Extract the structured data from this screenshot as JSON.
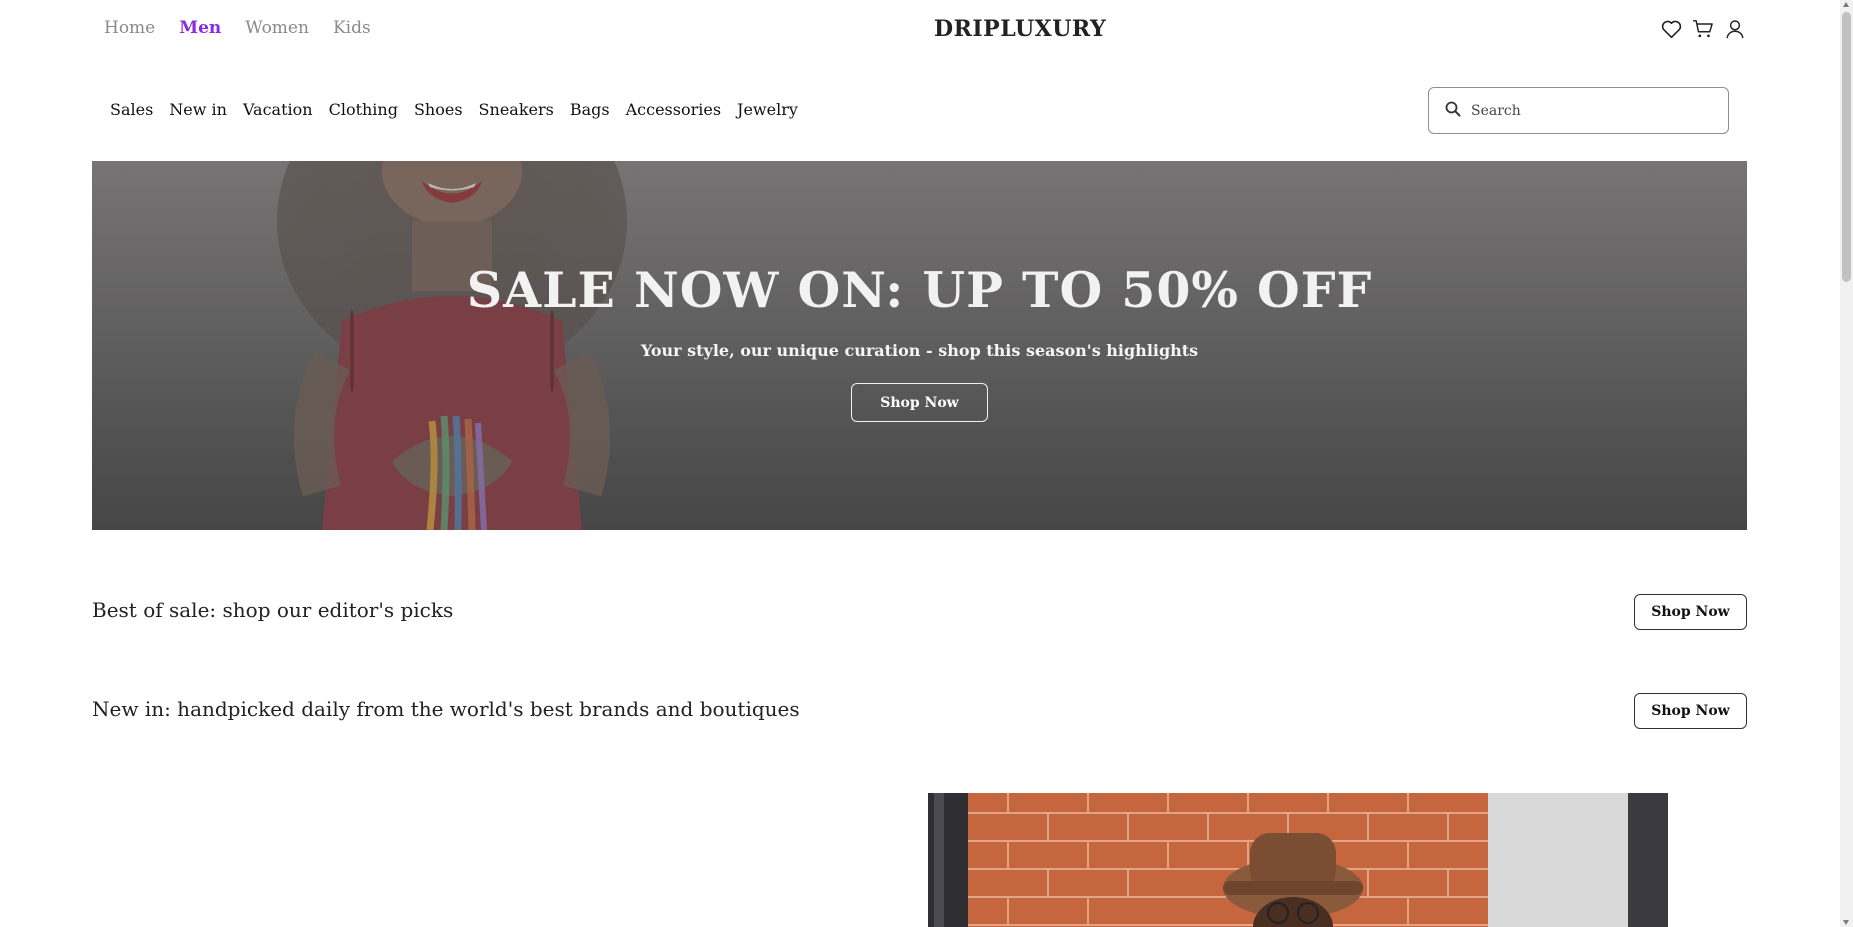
{
  "gender_nav": {
    "items": [
      {
        "label": "Home",
        "active": false
      },
      {
        "label": "Men",
        "active": true
      },
      {
        "label": "Women",
        "active": false
      },
      {
        "label": "Kids",
        "active": false
      }
    ]
  },
  "brand": {
    "name": "DRIPLUXURY"
  },
  "top_icons": [
    "heart-icon",
    "cart-icon",
    "user-icon"
  ],
  "category_nav": {
    "items": [
      "Sales",
      "New in",
      "Vacation",
      "Clothing",
      "Shoes",
      "Sneakers",
      "Bags",
      "Accessories",
      "Jewelry"
    ]
  },
  "search": {
    "placeholder": "Search",
    "value": ""
  },
  "hero": {
    "title": "SALE NOW ON: UP TO 50% OFF",
    "subtitle": "Your style, our unique curation - shop this season's highlights",
    "button_label": "Shop Now"
  },
  "promos": [
    {
      "text": "Best of sale: shop our editor's picks",
      "button_label": "Shop Now"
    },
    {
      "text": "New in: handpicked daily from the world's best brands and boutiques",
      "button_label": "Shop Now"
    }
  ],
  "colors": {
    "accent": "#8a2be2",
    "hero_overlay": "#6e6c6c"
  }
}
